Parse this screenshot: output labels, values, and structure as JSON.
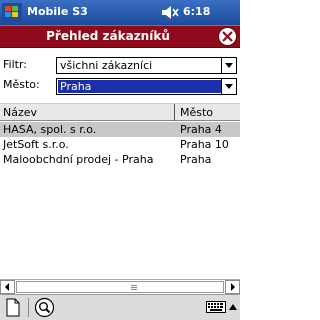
{
  "titlebar": {
    "app_title": "Mobile S3",
    "time": "6:18",
    "start_icon": "windows-flag-icon",
    "volume_icon": "speaker-icon"
  },
  "dialog": {
    "title": "Přehled zákazníků",
    "close_icon": "close-icon"
  },
  "filters": {
    "filtr_label": "Filtr:",
    "filtr_value": "všichni zákazníci",
    "mesto_label": "Město:",
    "mesto_value": "Praha"
  },
  "table": {
    "columns": [
      "Název",
      "Město"
    ],
    "rows": [
      {
        "name": "HASA, spol. s r.o.",
        "city": "Praha 4",
        "selected": true
      },
      {
        "name": "JetSoft s.r.o.",
        "city": "Praha 10",
        "selected": false
      },
      {
        "name": "Maloobchdní prodej - Praha",
        "city": "Praha",
        "selected": false
      }
    ]
  },
  "menubar": {
    "new_icon": "new-document-icon",
    "search_icon": "search-icon",
    "keyboard_icon": "keyboard-icon"
  },
  "colors": {
    "title_bar": "#1c4c9c",
    "dialog_header": "#8f0b1c",
    "selection_blue": "#1a2fa8",
    "row_selected": "#c8c8c8"
  }
}
